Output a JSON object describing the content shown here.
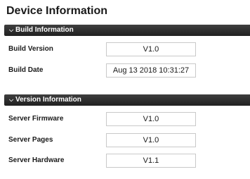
{
  "page": {
    "title": "Device Information"
  },
  "build_section": {
    "header": "Build Information",
    "icon": "chevron-down-icon",
    "rows": [
      {
        "label": "Build Version",
        "value": "V1.0"
      },
      {
        "label": "Build Date",
        "value": "Aug 13 2018 10:31:27"
      }
    ]
  },
  "version_section": {
    "header": "Version Information",
    "icon": "chevron-down-icon",
    "rows": [
      {
        "label": "Server Firmware",
        "value": "V1.0"
      },
      {
        "label": "Server Pages",
        "value": "V1.0"
      },
      {
        "label": "Server Hardware",
        "value": "V1.1"
      }
    ]
  },
  "colors": {
    "header_bg": "#2b2b2b",
    "header_text": "#ffffff",
    "box_border": "#c9c9c9"
  }
}
